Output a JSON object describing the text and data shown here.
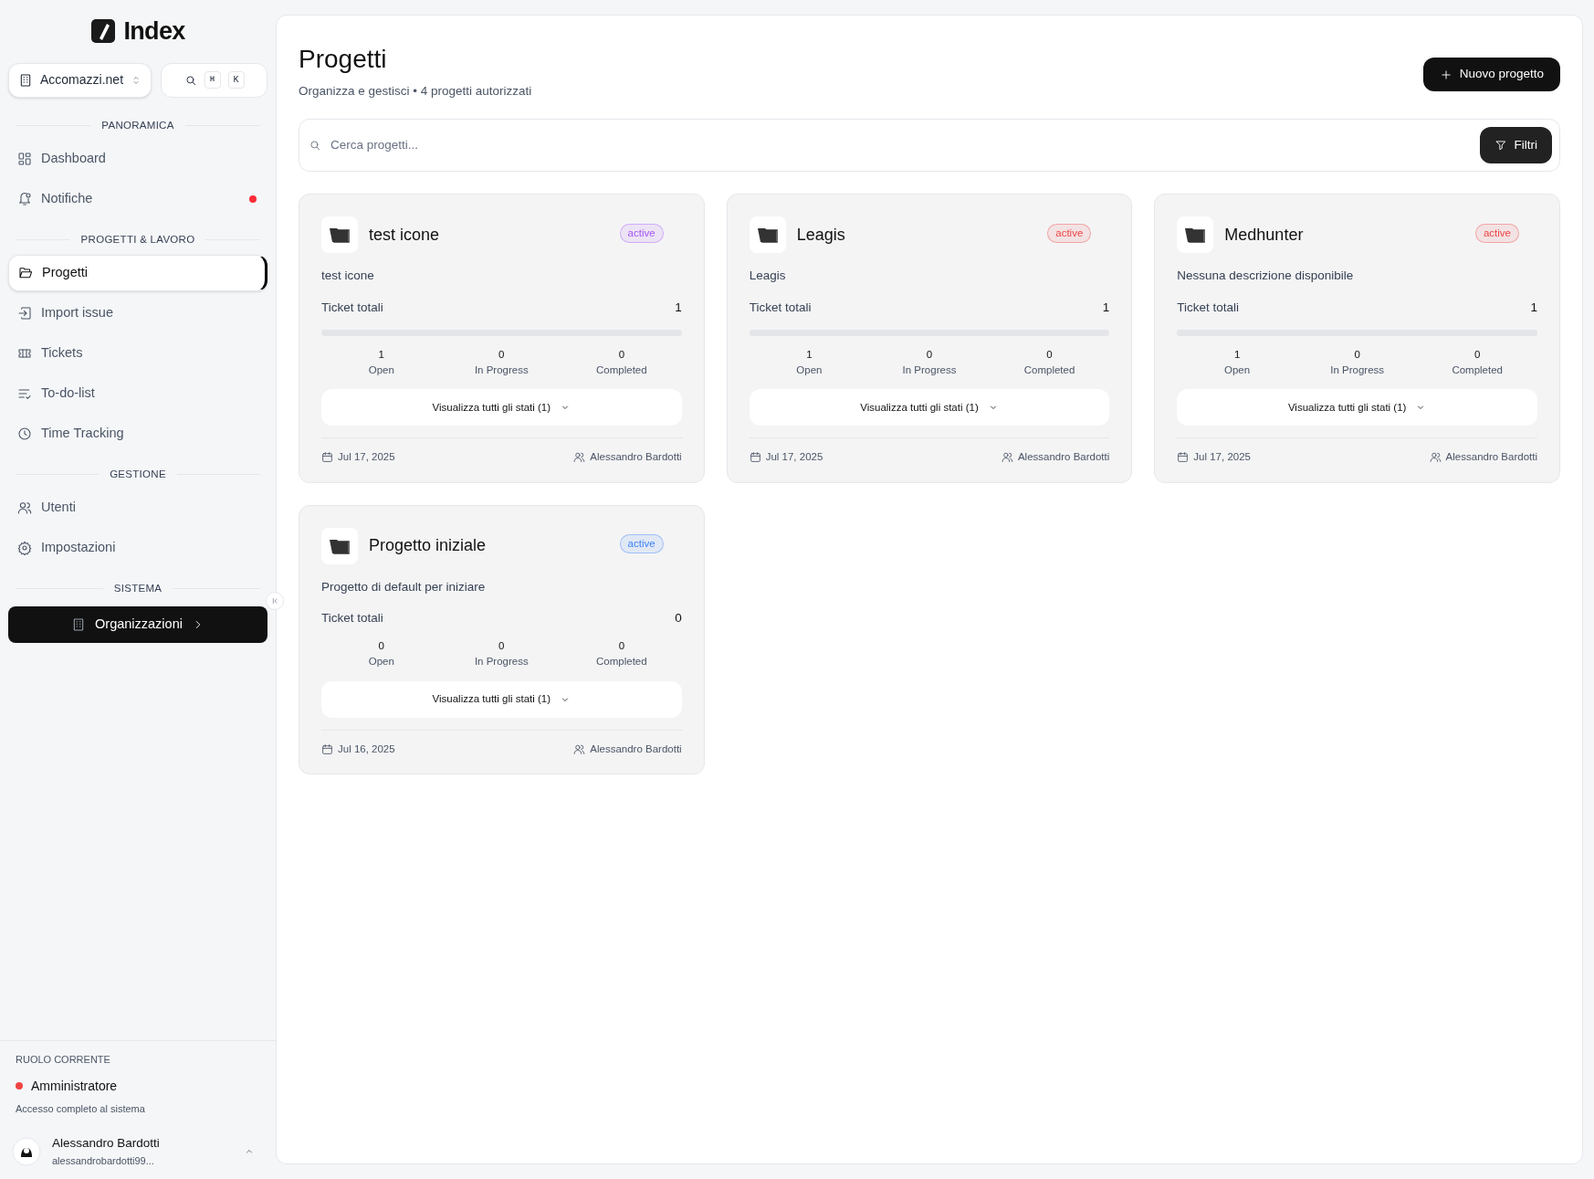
{
  "sidebar": {
    "logo": "Index",
    "org_switcher": {
      "label": "Accomazzi.net"
    },
    "search_keys": [
      "⌘",
      "K"
    ],
    "sections": [
      {
        "title": "PANORAMICA",
        "items": [
          {
            "label": "Dashboard",
            "selected": false,
            "unread": false
          },
          {
            "label": "Notifiche",
            "selected": false,
            "unread": true
          }
        ]
      },
      {
        "title": "PROGETTI & LAVORO",
        "items": [
          {
            "label": "Progetti",
            "selected": true,
            "unread": false
          },
          {
            "label": "Import issue",
            "selected": false,
            "unread": false
          },
          {
            "label": "Tickets",
            "selected": false,
            "unread": false
          },
          {
            "label": "To-do-list",
            "selected": false,
            "unread": false
          },
          {
            "label": "Time Tracking",
            "selected": false,
            "unread": false
          }
        ]
      },
      {
        "title": "GESTIONE",
        "items": [
          {
            "label": "Utenti",
            "selected": false,
            "unread": false
          },
          {
            "label": "Impostazioni",
            "selected": false,
            "unread": false
          }
        ]
      },
      {
        "title": "SISTEMA"
      }
    ],
    "system_button": "Organizzazioni",
    "role": {
      "heading": "RUOLO CORRENTE",
      "name": "Amministratore",
      "color": "#ef4444",
      "description": "Accesso completo al sistema"
    },
    "user": {
      "name": "Alessandro Bardotti",
      "email": "alessandrobardotti99..."
    }
  },
  "header": {
    "title": "Progetti",
    "subtitle": "Organizza e gestisci • 4 progetti autorizzati",
    "new_button": "Nuovo progetto"
  },
  "search": {
    "placeholder": "Cerca progetti...",
    "filter_button": "Filtri"
  },
  "projects": [
    {
      "name": "test icone",
      "status": "active",
      "color": "#a855f7",
      "description": "test icone",
      "total_label": "Ticket totali",
      "total": "1",
      "level": 0,
      "stats": [
        {
          "value": "1",
          "label": "Open"
        },
        {
          "value": "0",
          "label": "In Progress"
        },
        {
          "value": "0",
          "label": "Completed"
        }
      ],
      "states_button": "Visualizza tutti gli stati (1)",
      "date": "Jul 17, 2025",
      "owner": "Alessandro Bardotti"
    },
    {
      "name": "Leagis",
      "status": "active",
      "color": "#ef4444",
      "description": "Leagis",
      "total_label": "Ticket totali",
      "total": "1",
      "level": 0,
      "stats": [
        {
          "value": "1",
          "label": "Open"
        },
        {
          "value": "0",
          "label": "In Progress"
        },
        {
          "value": "0",
          "label": "Completed"
        }
      ],
      "states_button": "Visualizza tutti gli stati (1)",
      "date": "Jul 17, 2025",
      "owner": "Alessandro Bardotti"
    },
    {
      "name": "Medhunter",
      "status": "active",
      "color": "#ef4444",
      "description": "Nessuna descrizione disponibile",
      "total_label": "Ticket totali",
      "total": "1",
      "level": 0,
      "stats": [
        {
          "value": "1",
          "label": "Open"
        },
        {
          "value": "0",
          "label": "In Progress"
        },
        {
          "value": "0",
          "label": "Completed"
        }
      ],
      "states_button": "Visualizza tutti gli stati (1)",
      "date": "Jul 17, 2025",
      "owner": "Alessandro Bardotti"
    },
    {
      "name": "Progetto iniziale",
      "status": "active",
      "color": "#3b82f6",
      "description": "Progetto di default per iniziare",
      "total_label": "Ticket totali",
      "total": "0",
      "stats": [
        {
          "value": "0",
          "label": "Open"
        },
        {
          "value": "0",
          "label": "In Progress"
        },
        {
          "value": "0",
          "label": "Completed"
        }
      ],
      "states_button": "Visualizza tutti gli stati (1)",
      "date": "Jul 16, 2025",
      "owner": "Alessandro Bardotti"
    }
  ]
}
